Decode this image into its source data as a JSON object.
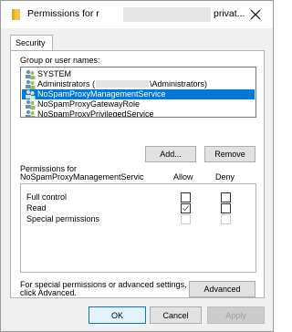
{
  "window": {
    "title_prefix": "Permissions for r",
    "title_suffix": "privat...",
    "close_glyph": "✕"
  },
  "tabs": [
    {
      "label": "Security"
    }
  ],
  "groups": {
    "label": "Group or user names:",
    "items": [
      {
        "name": "SYSTEM"
      },
      {
        "name_prefix": "Administrators (",
        "name_suffix": "\\Administrators)"
      },
      {
        "name": "NoSpamProxyManagementService",
        "selected": true
      },
      {
        "name": "NoSpamProxyGatewayRole"
      },
      {
        "name": "NoSpamProxyPrivilegedService"
      }
    ]
  },
  "buttons": {
    "add": "Add...",
    "remove": "Remove",
    "advanced": "Advanced",
    "ok": "OK",
    "cancel": "Cancel",
    "apply": "Apply"
  },
  "permissions": {
    "heading_line1": "Permissions for",
    "heading_line2": "NoSpamProxyManagementServic",
    "allow_label": "Allow",
    "deny_label": "Deny",
    "rows": [
      {
        "name": "Full control",
        "allow": false,
        "deny": false,
        "enabled": true
      },
      {
        "name": "Read",
        "allow": true,
        "deny": false,
        "enabled": true
      },
      {
        "name": "Special permissions",
        "allow": false,
        "deny": false,
        "enabled": false
      }
    ]
  },
  "advanced_hint": {
    "line1": "For special permissions or advanced settings,",
    "line2": "click Advanced."
  },
  "colors": {
    "selection": "#0078d7",
    "folder": "#f5c242"
  }
}
